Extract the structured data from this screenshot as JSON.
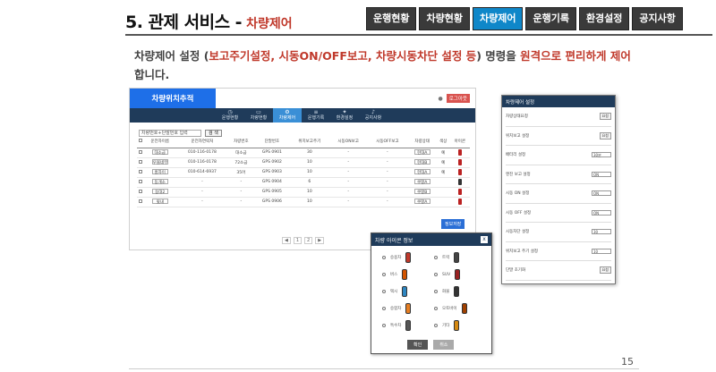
{
  "header": {
    "title": "5. 관제 서비스 -",
    "subtitle": "차량제어",
    "tabs": [
      {
        "label": "운행현황",
        "active": false
      },
      {
        "label": "차량현황",
        "active": false
      },
      {
        "label": "차량제어",
        "active": true
      },
      {
        "label": "운행기록",
        "active": false
      },
      {
        "label": "환경설정",
        "active": false
      },
      {
        "label": "공지사항",
        "active": false
      }
    ]
  },
  "description": {
    "part1": "차량제어 설정 (",
    "part2": "보고주기설정, 시동ON/OFF보고, 차량시동차단 설정 등",
    "part3": ") 명령을 ",
    "part4": "원격으로 편리하게 제어",
    "part5": "합니다."
  },
  "app": {
    "brand": "차량위치추적",
    "logout": "로그아웃",
    "nav": [
      "운행현황",
      "차량현황",
      "차량제어",
      "운행기록",
      "환경설정",
      "공지사항"
    ],
    "filter_placeholder": "차량번호+단말번호 입력",
    "search_label": "검 색",
    "columns": [
      "",
      "운전자이름",
      "운전자연락처",
      "차량번호",
      "단말번호",
      "위치보고주기",
      "보고주기",
      "시동ON보고",
      "시동OFF보고",
      "위치보고차단",
      "배터리",
      "정보",
      "차량상태",
      "색상",
      "아이콘"
    ],
    "rows": [
      {
        "name": "대소금",
        "phone": "010-116-0178",
        "plate": "대소금",
        "dev": "GPS 0901",
        "report": "30",
        "state": "현대A",
        "color": "예",
        "icon_color": "#b22"
      },
      {
        "name": "우볼네무",
        "phone": "010-116-0178",
        "plate": "72소금",
        "dev": "GPS 0902",
        "report": "10",
        "state": "현대B",
        "color": "예",
        "icon_color": "#b22"
      },
      {
        "name": "홍자이",
        "phone": "010-614-6937",
        "plate": "35어",
        "dev": "GPS 0903",
        "report": "10",
        "state": "현대A",
        "color": "예",
        "icon_color": "#b22"
      },
      {
        "name": "동개소",
        "phone": "-",
        "plate": "-",
        "dev": "GPS 0904",
        "report": "6",
        "state": "쿠팡A",
        "color": "",
        "icon_color": "#333"
      },
      {
        "name": "동대2",
        "phone": "-",
        "plate": "-",
        "dev": "GPS 0905",
        "report": "10",
        "state": "쿠팡B",
        "color": "",
        "icon_color": "#b22"
      },
      {
        "name": "윗내",
        "phone": "-",
        "plate": "-",
        "dev": "GPS 0906",
        "report": "10",
        "state": "쿠팡A",
        "color": "",
        "icon_color": "#b22"
      }
    ],
    "save_label": "정보저장",
    "pager": [
      "◀",
      "1",
      "2",
      "▶"
    ]
  },
  "popup": {
    "title": "차량 아이콘 정보",
    "close": "x",
    "options": [
      {
        "label": "승용차",
        "color": "#c0392b"
      },
      {
        "label": "트럭",
        "color": "#444444"
      },
      {
        "label": "버스",
        "color": "#d35400"
      },
      {
        "label": "SUV",
        "color": "#922"
      },
      {
        "label": "택시",
        "color": "#2e86c1"
      },
      {
        "label": "화물",
        "color": "#333"
      },
      {
        "label": "승합차",
        "color": "#e67e22"
      },
      {
        "label": "오토바이",
        "color": "#a04000"
      },
      {
        "label": "특수차",
        "color": "#555"
      },
      {
        "label": "기타",
        "color": "#d68910"
      }
    ],
    "ok_label": "확인",
    "cancel_label": "취소"
  },
  "panel": {
    "title": "차량제어 설정",
    "rows": [
      {
        "label": "차량상태요청",
        "control": "button",
        "value": "요청"
      },
      {
        "label": "위치보고 설정",
        "control": "button",
        "value": "요청"
      },
      {
        "label": "배터리 설정",
        "control": "select",
        "value": "30분"
      },
      {
        "label": "엔진 보고 설정",
        "control": "select",
        "value": "ON"
      },
      {
        "label": "시동 ON 설정",
        "control": "select",
        "value": "ON"
      },
      {
        "label": "시동 OFF 설정",
        "control": "select",
        "value": "ON"
      },
      {
        "label": "시동차단 설정",
        "control": "select",
        "value": "30"
      },
      {
        "label": "위치보고 주기 설정",
        "control": "select",
        "value": "10"
      },
      {
        "label": "단말 초기화",
        "control": "button",
        "value": "요청"
      }
    ]
  },
  "page_number": "15"
}
